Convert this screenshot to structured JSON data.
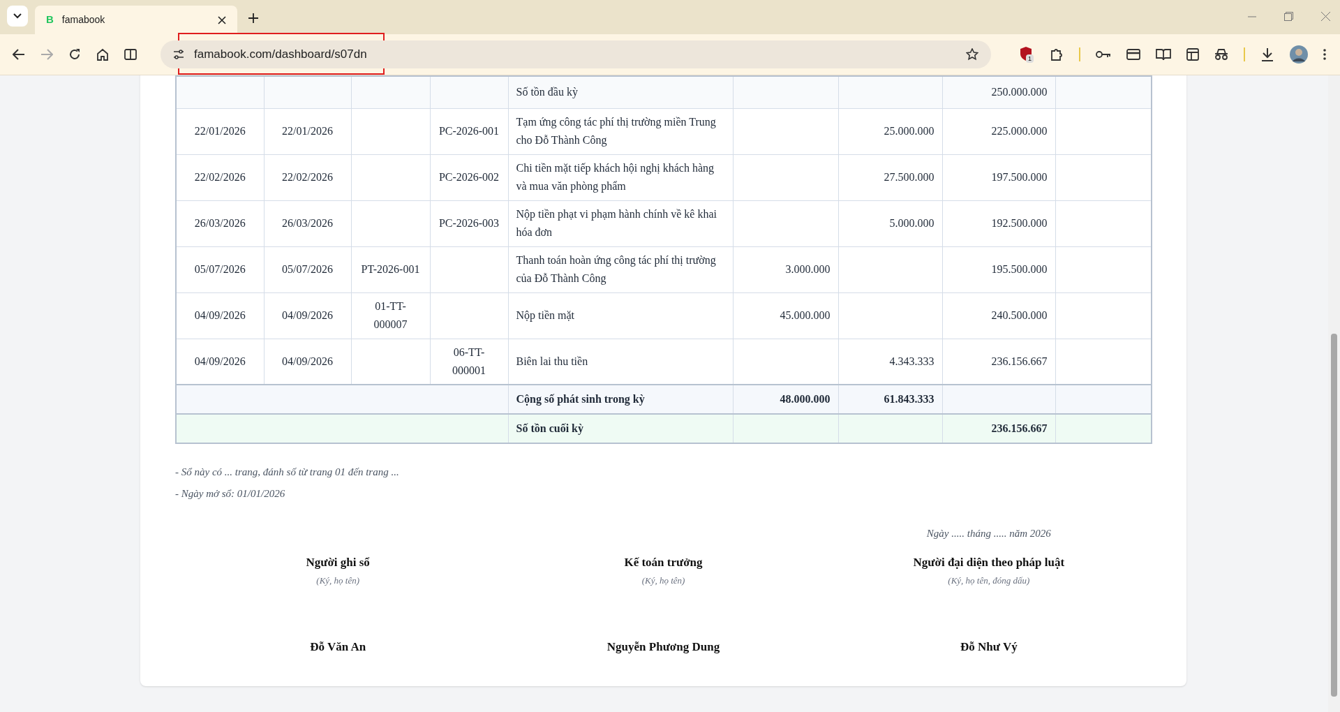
{
  "browser": {
    "tab": {
      "favicon": "B",
      "title": "famabook",
      "selected": true
    },
    "url": "famabook.com/dashboard/s07dn",
    "extension_badge": "1"
  },
  "ledger": {
    "rows": [
      {
        "kind": "opening",
        "column_5": "Số tồn đầu kỳ",
        "column_8": "250.000.000"
      },
      {
        "kind": "entry",
        "column_1": "22/01/2026",
        "column_2": "22/01/2026",
        "column_4": "PC-2026-001",
        "column_5": "Tạm ứng công tác phí thị trường miền Trung cho Đỗ Thành Công",
        "column_7": "25.000.000",
        "column_8": "225.000.000"
      },
      {
        "kind": "entry",
        "column_1": "22/02/2026",
        "column_2": "22/02/2026",
        "column_4": "PC-2026-002",
        "column_5": "Chi tiền mặt tiếp khách hội nghị khách hàng và mua văn phòng phẩm",
        "column_7": "27.500.000",
        "column_8": "197.500.000"
      },
      {
        "kind": "entry",
        "column_1": "26/03/2026",
        "column_2": "26/03/2026",
        "column_4": "PC-2026-003",
        "column_5": "Nộp tiền phạt vi phạm hành chính về kê khai hóa đơn",
        "column_7": "5.000.000",
        "column_8": "192.500.000"
      },
      {
        "kind": "entry",
        "column_1": "05/07/2026",
        "column_2": "05/07/2026",
        "column_3": "PT-2026-001",
        "column_5": "Thanh toán hoàn ứng công tác phí thị trường của Đỗ Thành Công",
        "column_6": "3.000.000",
        "column_8": "195.500.000"
      },
      {
        "kind": "entry",
        "column_1": "04/09/2026",
        "column_2": "04/09/2026",
        "column_3": "01-TT-000007",
        "column_5": "Nộp tiền mặt",
        "column_6": "45.000.000",
        "column_8": "240.500.000"
      },
      {
        "kind": "entry",
        "column_1": "04/09/2026",
        "column_2": "04/09/2026",
        "column_4": "06-TT-000001",
        "column_5": "Biên lai thu tiền",
        "column_7": "4.343.333",
        "column_8": "236.156.667"
      },
      {
        "kind": "total",
        "column_5": "Cộng số phát sinh trong kỳ",
        "column_6": "48.000.000",
        "column_7": "61.843.333"
      },
      {
        "kind": "closing",
        "column_5": "Số tồn cuối kỳ",
        "column_8": "236.156.667"
      }
    ]
  },
  "notes": [
    "- Sổ này có ... trang, đánh số từ trang 01 đến trang ...",
    "- Ngày mở sổ: 01/01/2026"
  ],
  "signature_date": "Ngày ..... tháng ..... năm 2026",
  "signatures": [
    {
      "role": "Người ghi sổ",
      "hint": "(Ký, họ tên)",
      "name": "Đỗ Văn An"
    },
    {
      "role": "Kế toán trưởng",
      "hint": "(Ký, họ tên)",
      "name": "Nguyễn Phương Dung"
    },
    {
      "role": "Người đại diện theo pháp luật",
      "hint": "(Ký, họ tên, đóng dấu)",
      "name": "Đỗ Như Vý"
    }
  ]
}
